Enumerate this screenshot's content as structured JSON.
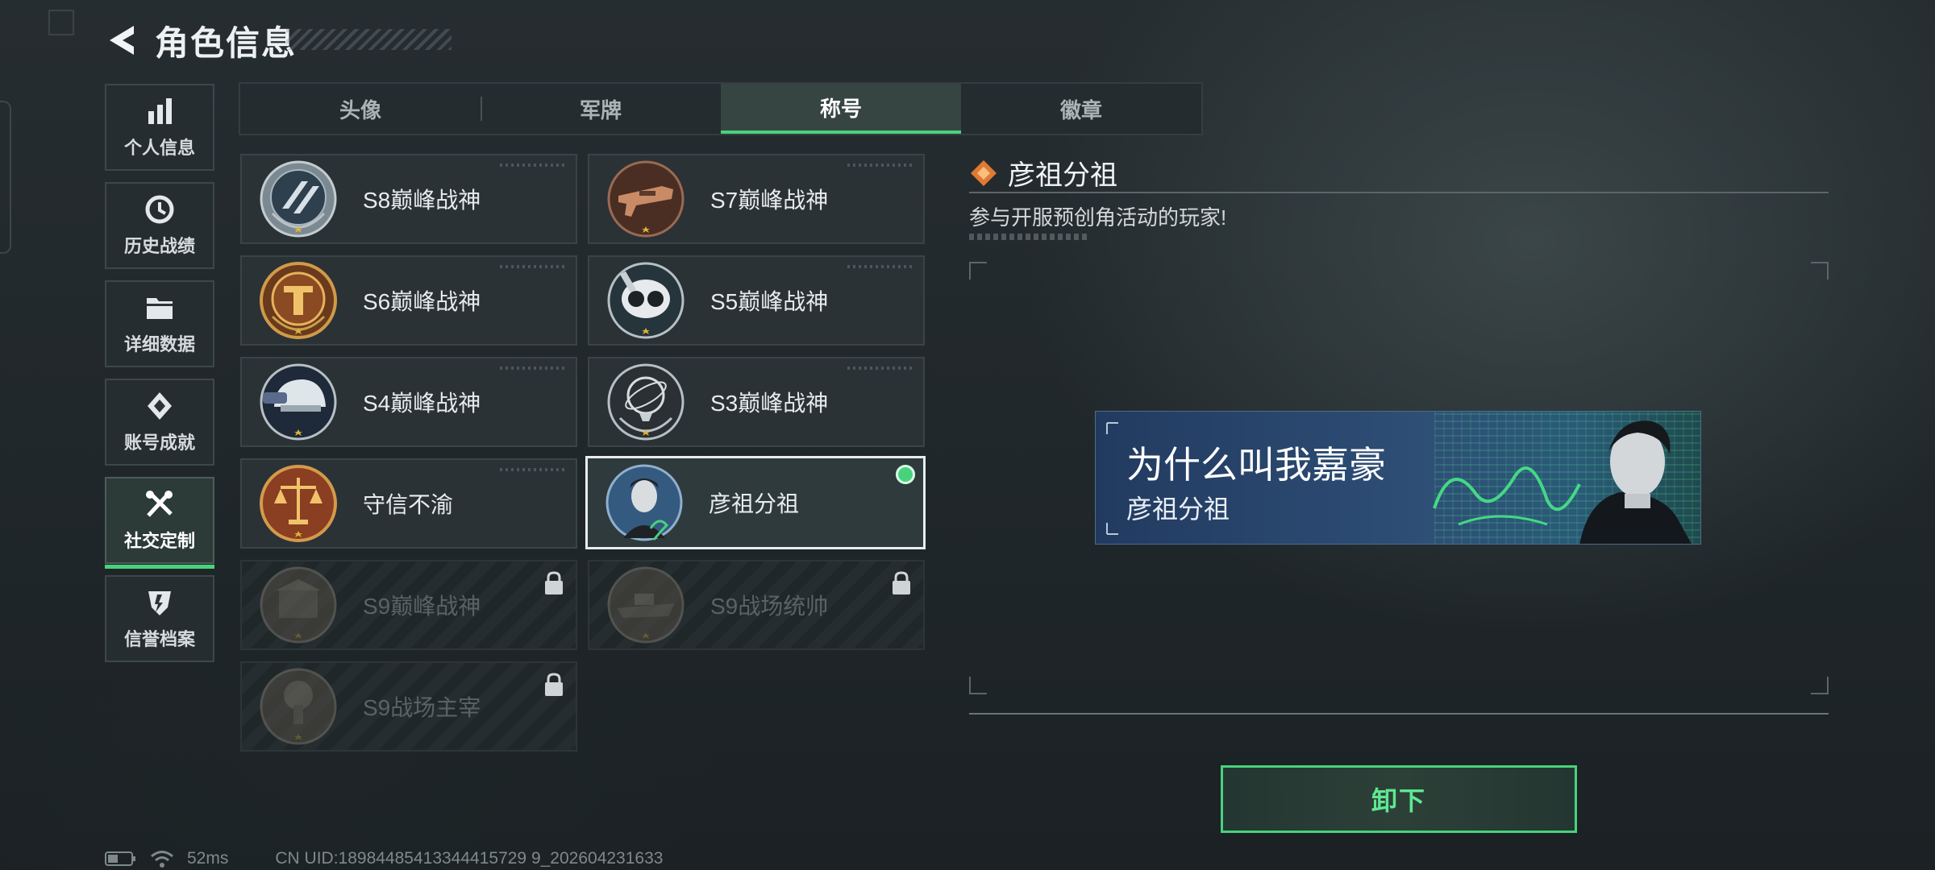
{
  "header": {
    "title": "角色信息"
  },
  "nav": [
    {
      "label": "个人信息",
      "icon": "bar-chart-icon"
    },
    {
      "label": "历史战绩",
      "icon": "history-icon"
    },
    {
      "label": "详细数据",
      "icon": "folder-icon"
    },
    {
      "label": "账号成就",
      "icon": "achievement-icon"
    },
    {
      "label": "社交定制",
      "icon": "tools-icon",
      "active": true
    },
    {
      "label": "信誉档案",
      "icon": "credit-shield-icon"
    }
  ],
  "tabs": [
    {
      "label": "头像"
    },
    {
      "label": "军牌"
    },
    {
      "label": "称号",
      "active": true
    },
    {
      "label": "徽章"
    }
  ],
  "titles": [
    {
      "name": "S8巅峰战神",
      "state": "unlocked"
    },
    {
      "name": "S7巅峰战神",
      "state": "unlocked"
    },
    {
      "name": "S6巅峰战神",
      "state": "unlocked"
    },
    {
      "name": "S5巅峰战神",
      "state": "unlocked"
    },
    {
      "name": "S4巅峰战神",
      "state": "unlocked"
    },
    {
      "name": "S3巅峰战神",
      "state": "unlocked"
    },
    {
      "name": "守信不渝",
      "state": "unlocked"
    },
    {
      "name": "彦祖分祖",
      "state": "selected-equipped"
    },
    {
      "name": "S9巅峰战神",
      "state": "locked"
    },
    {
      "name": "S9战场统帅",
      "state": "locked"
    },
    {
      "name": "S9战场主宰",
      "state": "locked"
    }
  ],
  "detail": {
    "title": "彦祖分祖",
    "description": "参与开服预创角活动的玩家!",
    "banner_main": "为什么叫我嘉豪",
    "banner_sub": "彦祖分祖"
  },
  "actions": {
    "unequip_label": "卸下"
  },
  "status": {
    "ping": "52ms",
    "uid": "CN UID:18984485413344415729 9_202604231633"
  },
  "colors": {
    "accent": "#49d27c",
    "background": "#22292c",
    "banner": "#2e4f76"
  }
}
